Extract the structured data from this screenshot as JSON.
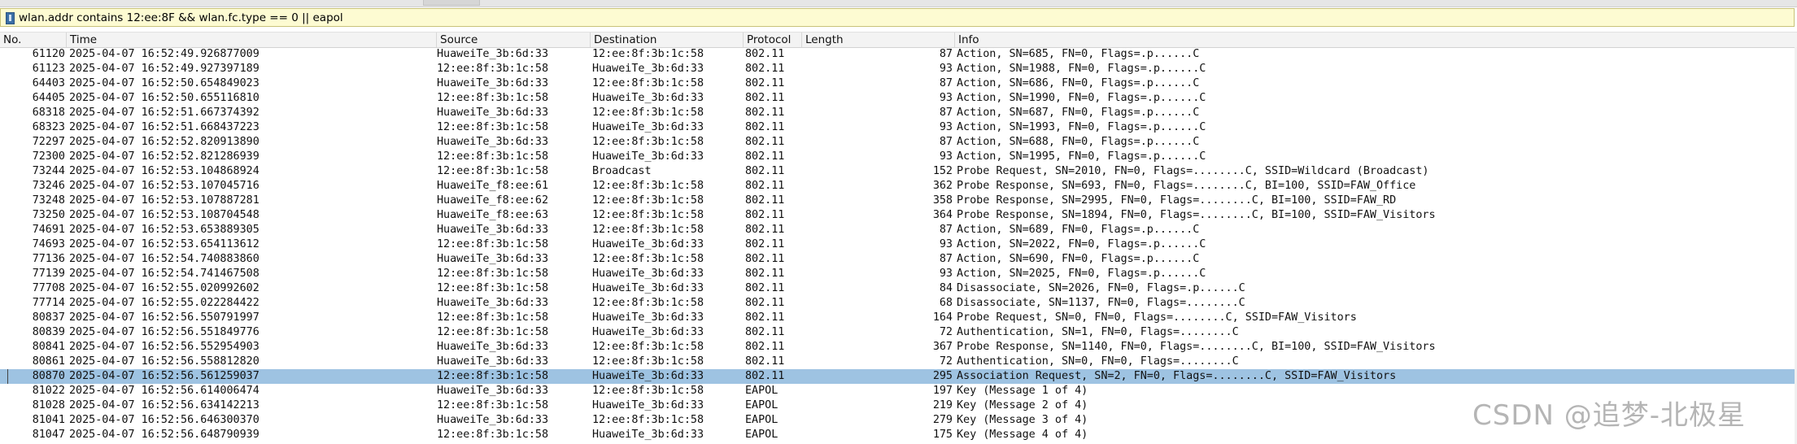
{
  "filter": {
    "value": "wlan.addr contains 12:ee:8F && wlan.fc.type == 0 || eapol"
  },
  "columns": {
    "no": "No.",
    "time": "Time",
    "source": "Source",
    "destination": "Destination",
    "protocol": "Protocol",
    "length": "Length",
    "info": "Info"
  },
  "packets": [
    {
      "no": "61120",
      "time": "2025-04-07 16:52:49.926877009",
      "source": "HuaweiTe_3b:6d:33",
      "destination": "12:ee:8f:3b:1c:58",
      "protocol": "802.11",
      "length": "87",
      "info": "Action, SN=685, FN=0, Flags=.p......C"
    },
    {
      "no": "61123",
      "time": "2025-04-07 16:52:49.927397189",
      "source": "12:ee:8f:3b:1c:58",
      "destination": "HuaweiTe_3b:6d:33",
      "protocol": "802.11",
      "length": "93",
      "info": "Action, SN=1988, FN=0, Flags=.p......C"
    },
    {
      "no": "64403",
      "time": "2025-04-07 16:52:50.654849023",
      "source": "HuaweiTe_3b:6d:33",
      "destination": "12:ee:8f:3b:1c:58",
      "protocol": "802.11",
      "length": "87",
      "info": "Action, SN=686, FN=0, Flags=.p......C"
    },
    {
      "no": "64405",
      "time": "2025-04-07 16:52:50.655116810",
      "source": "12:ee:8f:3b:1c:58",
      "destination": "HuaweiTe_3b:6d:33",
      "protocol": "802.11",
      "length": "93",
      "info": "Action, SN=1990, FN=0, Flags=.p......C"
    },
    {
      "no": "68318",
      "time": "2025-04-07 16:52:51.667374392",
      "source": "HuaweiTe_3b:6d:33",
      "destination": "12:ee:8f:3b:1c:58",
      "protocol": "802.11",
      "length": "87",
      "info": "Action, SN=687, FN=0, Flags=.p......C"
    },
    {
      "no": "68323",
      "time": "2025-04-07 16:52:51.668437223",
      "source": "12:ee:8f:3b:1c:58",
      "destination": "HuaweiTe_3b:6d:33",
      "protocol": "802.11",
      "length": "93",
      "info": "Action, SN=1993, FN=0, Flags=.p......C"
    },
    {
      "no": "72297",
      "time": "2025-04-07 16:52:52.820913890",
      "source": "HuaweiTe_3b:6d:33",
      "destination": "12:ee:8f:3b:1c:58",
      "protocol": "802.11",
      "length": "87",
      "info": "Action, SN=688, FN=0, Flags=.p......C"
    },
    {
      "no": "72300",
      "time": "2025-04-07 16:52:52.821286939",
      "source": "12:ee:8f:3b:1c:58",
      "destination": "HuaweiTe_3b:6d:33",
      "protocol": "802.11",
      "length": "93",
      "info": "Action, SN=1995, FN=0, Flags=.p......C"
    },
    {
      "no": "73244",
      "time": "2025-04-07 16:52:53.104868924",
      "source": "12:ee:8f:3b:1c:58",
      "destination": "Broadcast",
      "protocol": "802.11",
      "length": "152",
      "info": "Probe Request, SN=2010, FN=0, Flags=........C, SSID=Wildcard (Broadcast)"
    },
    {
      "no": "73246",
      "time": "2025-04-07 16:52:53.107045716",
      "source": "HuaweiTe_f8:ee:61",
      "destination": "12:ee:8f:3b:1c:58",
      "protocol": "802.11",
      "length": "362",
      "info": "Probe Response, SN=693, FN=0, Flags=........C, BI=100, SSID=FAW_Office"
    },
    {
      "no": "73248",
      "time": "2025-04-07 16:52:53.107887281",
      "source": "HuaweiTe_f8:ee:62",
      "destination": "12:ee:8f:3b:1c:58",
      "protocol": "802.11",
      "length": "358",
      "info": "Probe Response, SN=2995, FN=0, Flags=........C, BI=100, SSID=FAW_RD"
    },
    {
      "no": "73250",
      "time": "2025-04-07 16:52:53.108704548",
      "source": "HuaweiTe_f8:ee:63",
      "destination": "12:ee:8f:3b:1c:58",
      "protocol": "802.11",
      "length": "364",
      "info": "Probe Response, SN=1894, FN=0, Flags=........C, BI=100, SSID=FAW_Visitors"
    },
    {
      "no": "74691",
      "time": "2025-04-07 16:52:53.653889305",
      "source": "HuaweiTe_3b:6d:33",
      "destination": "12:ee:8f:3b:1c:58",
      "protocol": "802.11",
      "length": "87",
      "info": "Action, SN=689, FN=0, Flags=.p......C"
    },
    {
      "no": "74693",
      "time": "2025-04-07 16:52:53.654113612",
      "source": "12:ee:8f:3b:1c:58",
      "destination": "HuaweiTe_3b:6d:33",
      "protocol": "802.11",
      "length": "93",
      "info": "Action, SN=2022, FN=0, Flags=.p......C"
    },
    {
      "no": "77136",
      "time": "2025-04-07 16:52:54.740883860",
      "source": "HuaweiTe_3b:6d:33",
      "destination": "12:ee:8f:3b:1c:58",
      "protocol": "802.11",
      "length": "87",
      "info": "Action, SN=690, FN=0, Flags=.p......C"
    },
    {
      "no": "77139",
      "time": "2025-04-07 16:52:54.741467508",
      "source": "12:ee:8f:3b:1c:58",
      "destination": "HuaweiTe_3b:6d:33",
      "protocol": "802.11",
      "length": "93",
      "info": "Action, SN=2025, FN=0, Flags=.p......C"
    },
    {
      "no": "77708",
      "time": "2025-04-07 16:52:55.020992602",
      "source": "12:ee:8f:3b:1c:58",
      "destination": "HuaweiTe_3b:6d:33",
      "protocol": "802.11",
      "length": "84",
      "info": "Disassociate, SN=2026, FN=0, Flags=.p......C"
    },
    {
      "no": "77714",
      "time": "2025-04-07 16:52:55.022284422",
      "source": "HuaweiTe_3b:6d:33",
      "destination": "12:ee:8f:3b:1c:58",
      "protocol": "802.11",
      "length": "68",
      "info": "Disassociate, SN=1137, FN=0, Flags=........C"
    },
    {
      "no": "80837",
      "time": "2025-04-07 16:52:56.550791997",
      "source": "12:ee:8f:3b:1c:58",
      "destination": "HuaweiTe_3b:6d:33",
      "protocol": "802.11",
      "length": "164",
      "info": "Probe Request, SN=0, FN=0, Flags=........C, SSID=FAW_Visitors"
    },
    {
      "no": "80839",
      "time": "2025-04-07 16:52:56.551849776",
      "source": "12:ee:8f:3b:1c:58",
      "destination": "HuaweiTe_3b:6d:33",
      "protocol": "802.11",
      "length": "72",
      "info": "Authentication, SN=1, FN=0, Flags=........C"
    },
    {
      "no": "80841",
      "time": "2025-04-07 16:52:56.552954903",
      "source": "HuaweiTe_3b:6d:33",
      "destination": "12:ee:8f:3b:1c:58",
      "protocol": "802.11",
      "length": "367",
      "info": "Probe Response, SN=1140, FN=0, Flags=........C, BI=100, SSID=FAW_Visitors"
    },
    {
      "no": "80861",
      "time": "2025-04-07 16:52:56.558812820",
      "source": "HuaweiTe_3b:6d:33",
      "destination": "12:ee:8f:3b:1c:58",
      "protocol": "802.11",
      "length": "72",
      "info": "Authentication, SN=0, FN=0, Flags=........C"
    },
    {
      "no": "80870",
      "time": "2025-04-07 16:52:56.561259037",
      "source": "12:ee:8f:3b:1c:58",
      "destination": "HuaweiTe_3b:6d:33",
      "protocol": "802.11",
      "length": "295",
      "info": "Association Request, SN=2, FN=0, Flags=........C, SSID=FAW_Visitors",
      "selected": true
    },
    {
      "no": "81022",
      "time": "2025-04-07 16:52:56.614006474",
      "source": "HuaweiTe_3b:6d:33",
      "destination": "12:ee:8f:3b:1c:58",
      "protocol": "EAPOL",
      "length": "197",
      "info": "Key (Message 1 of 4)"
    },
    {
      "no": "81028",
      "time": "2025-04-07 16:52:56.634142213",
      "source": "12:ee:8f:3b:1c:58",
      "destination": "HuaweiTe_3b:6d:33",
      "protocol": "EAPOL",
      "length": "219",
      "info": "Key (Message 2 of 4)"
    },
    {
      "no": "81041",
      "time": "2025-04-07 16:52:56.646300370",
      "source": "HuaweiTe_3b:6d:33",
      "destination": "12:ee:8f:3b:1c:58",
      "protocol": "EAPOL",
      "length": "279",
      "info": "Key (Message 3 of 4)"
    },
    {
      "no": "81047",
      "time": "2025-04-07 16:52:56.648790939",
      "source": "12:ee:8f:3b:1c:58",
      "destination": "HuaweiTe_3b:6d:33",
      "protocol": "EAPOL",
      "length": "175",
      "info": "Key (Message 4 of 4)"
    }
  ],
  "watermark": "CSDN @追梦-北极星",
  "colors": {
    "filter_background": "#fdfbd2",
    "selected_row": "#9ec3e2",
    "header_background": "#f3f3f3"
  }
}
